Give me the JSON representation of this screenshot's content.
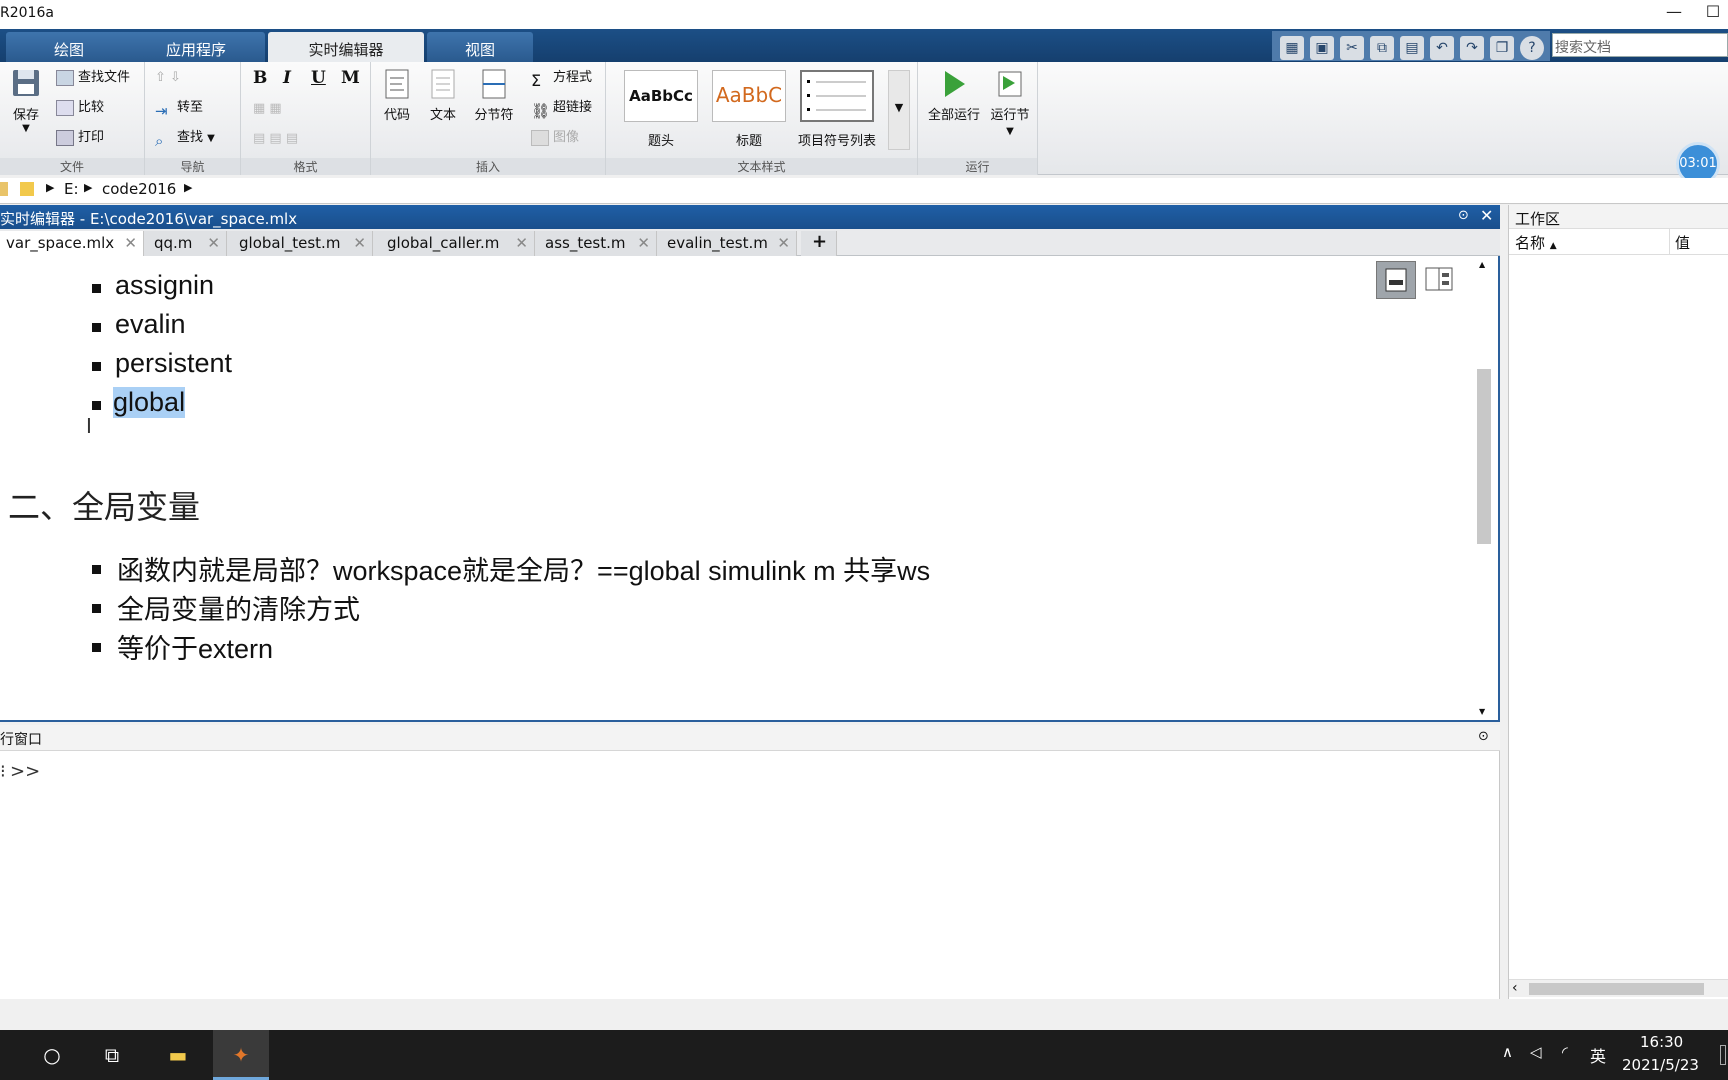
{
  "window": {
    "title": "R2016a",
    "minimize": "—",
    "maximize": "☐"
  },
  "ribbon_tabs": [
    "绘图",
    "应用程序",
    "实时编辑器",
    "视图"
  ],
  "search": {
    "placeholder": "搜索文档"
  },
  "timer": "03:01",
  "ribbon": {
    "file": {
      "save": "保存",
      "find_files": "查找文件",
      "compare": "比较",
      "print": "打印",
      "label": "文件"
    },
    "nav": {
      "goto": "转至",
      "find": "查找",
      "label": "导航"
    },
    "format": {
      "bold": "B",
      "italic": "I",
      "underline": "U",
      "mono": "M",
      "label": "格式"
    },
    "insert": {
      "code": "代码",
      "text": "文本",
      "section_break": "分节符",
      "equation": "方程式",
      "hyperlink": "超链接",
      "image": "图像",
      "label": "插入"
    },
    "text_style": {
      "title_preview": "AaBbCc",
      "heading_preview": "AaBbC",
      "title": "题头",
      "heading": "标题",
      "bulleted": "项目符号列表",
      "label": "文本样式"
    },
    "run": {
      "run_all": "全部运行",
      "run_section": "运行节",
      "label": "运行"
    }
  },
  "address": {
    "drive": "E:",
    "folder": "code2016"
  },
  "editor": {
    "title": "实时编辑器 - E:\\code2016\\var_space.mlx",
    "tabs": [
      "var_space.mlx",
      "qq.m",
      "global_test.m",
      "global_caller.m",
      "ass_test.m",
      "evalin_test.m"
    ],
    "add_tab": "+",
    "list1": [
      "assignin",
      "evalin",
      "persistent",
      "global"
    ],
    "heading": "二、全局变量",
    "list2": [
      "函数内就是局部？workspace就是全局？==global simulink m 共享ws",
      "全局变量的清除方式",
      "等价于extern"
    ]
  },
  "command_window": {
    "title": "行窗口",
    "prompt": ">>"
  },
  "workspace": {
    "title": "工作区",
    "col_name": "名称",
    "col_value": "值"
  },
  "taskbar": {
    "ime": "英",
    "time": "16:30",
    "date": "2021/5/23"
  }
}
